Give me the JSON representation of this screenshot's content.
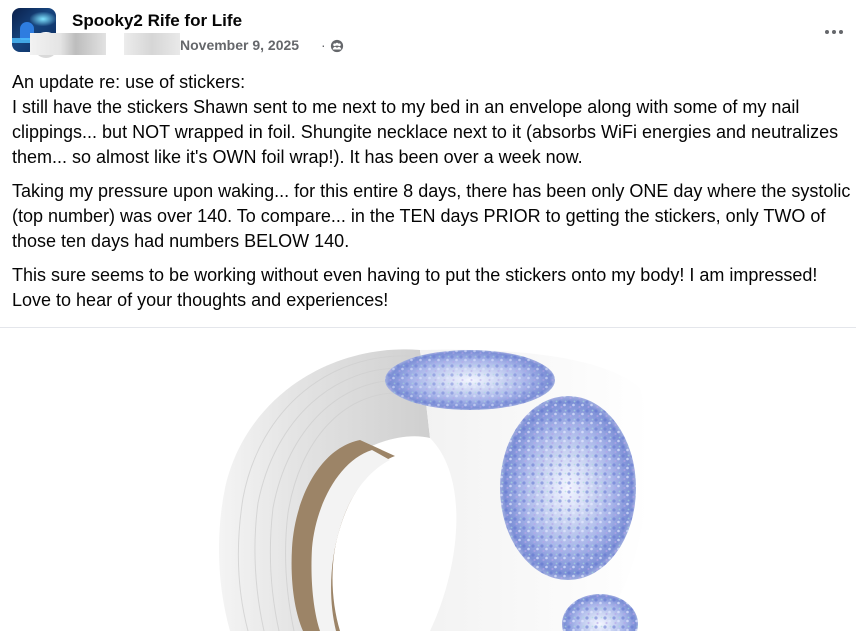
{
  "post": {
    "group_name": "Spooky2 Rife for Life",
    "date": "November 9, 2025",
    "separator": "·",
    "audience_icon": "group-audience-icon",
    "more_icon": "more-options-icon",
    "paragraphs": [
      "An update re: use of stickers:\nI still have the stickers Shawn sent to me next to my bed in an envelope along with some of my nail clippings... but NOT wrapped in foil.  Shungite necklace next to it (absorbs WiFi energies and neutralizes them... so almost like it's OWN foil wrap!). It has been over a week now.",
      "Taking my pressure upon waking... for this entire 8 days, there has been only ONE day where the systolic (top number) was over 140. To compare... in the TEN days PRIOR to getting the stickers, only TWO of those ten days had numbers BELOW 140.",
      "This sure seems to be working without even having to put the stickers onto my body!  I am impressed! Love to hear of your thoughts and experiences!"
    ]
  },
  "photo": {
    "subject": "holographic-sticker-roll"
  }
}
